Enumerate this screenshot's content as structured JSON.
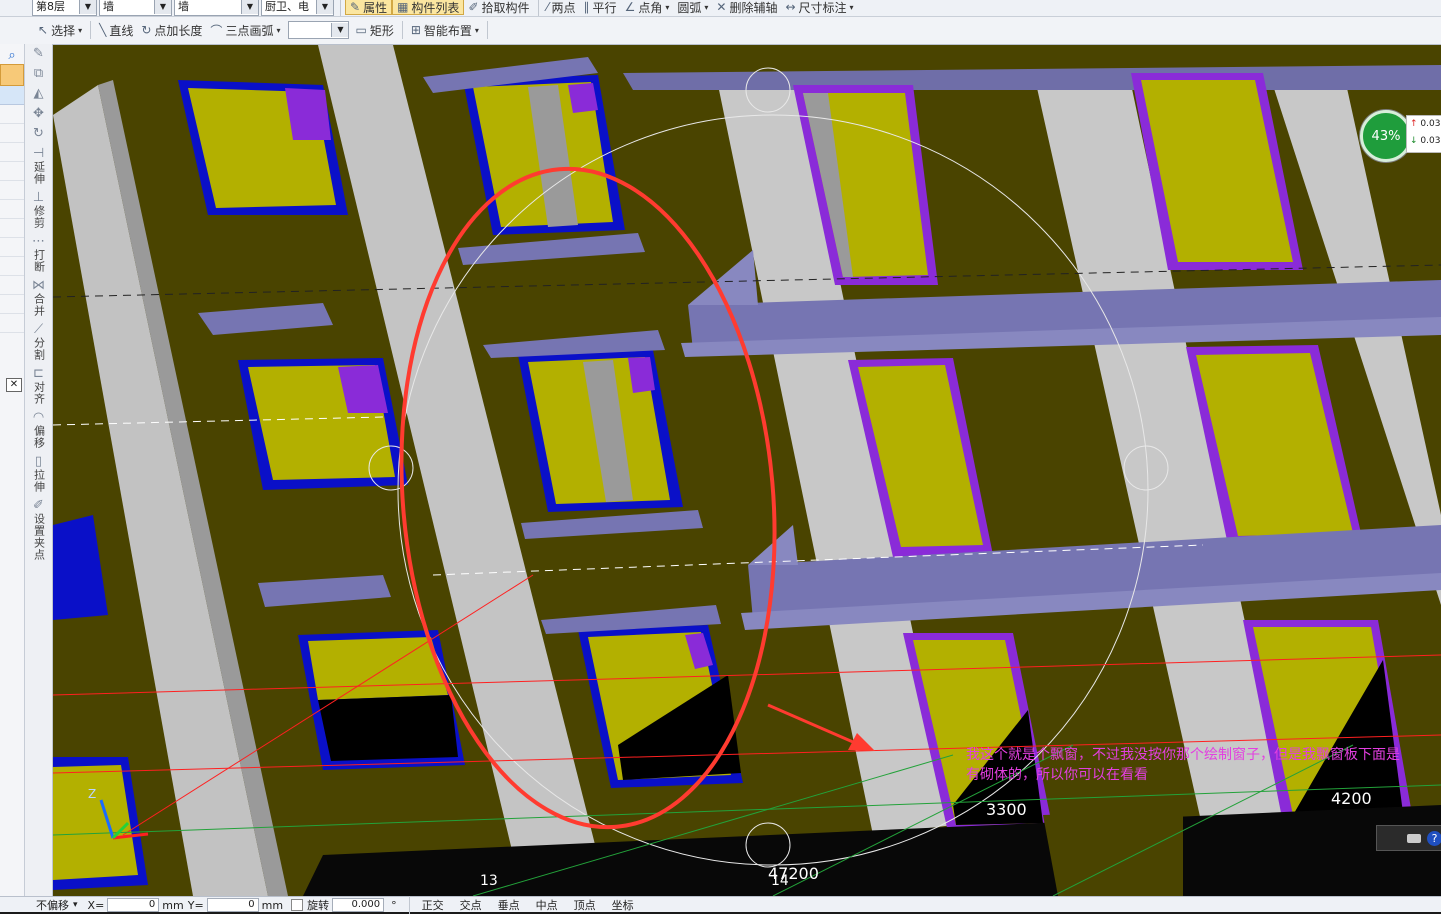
{
  "toolbar_top": {
    "floor_select": "第8层",
    "type_select_1": "墙",
    "type_select_2": "墙",
    "sub_select": "厨卫、电",
    "props_button": "属性",
    "component_list_button": "构件列表",
    "pick_component_button": "拾取构件",
    "two_points_button": "两点",
    "parallel_button": "平行",
    "point_angle_button": "点角",
    "arc_button": "圆弧",
    "delete_aux_button": "删除辅轴",
    "dimension_button": "尺寸标注"
  },
  "toolbar_draw": {
    "select_button": "选择",
    "line_button": "直线",
    "point_length_button": "点加长度",
    "three_point_arc_button": "三点画弧",
    "rect_button": "矩形",
    "smart_layout_button": "智能布置"
  },
  "left_tools": [
    {
      "icon": "pencil-icon",
      "label": ""
    },
    {
      "icon": "copy-icon",
      "label": ""
    },
    {
      "icon": "mirror-icon",
      "label": ""
    },
    {
      "icon": "move-icon",
      "label": ""
    },
    {
      "icon": "rotate-icon",
      "label": ""
    },
    {
      "icon": "extend-icon",
      "label": "延伸"
    },
    {
      "icon": "trim-icon",
      "label": "修剪"
    },
    {
      "icon": "break-icon",
      "label": "打断"
    },
    {
      "icon": "merge-icon",
      "label": "合并"
    },
    {
      "icon": "split-icon",
      "label": "分割"
    },
    {
      "icon": "align-icon",
      "label": "对齐"
    },
    {
      "icon": "offset-icon",
      "label": "偏移"
    },
    {
      "icon": "stretch-icon",
      "label": "拉伸"
    },
    {
      "icon": "grip-icon",
      "label": "设置夹点"
    }
  ],
  "viewport": {
    "annotation_text": "我这个就是个飘窗，不过我没按你那个绘制窗子，但是我飘窗板下面是有砌体的，所以你可以在看看",
    "dim_3300": "3300",
    "dim_4200": "4200",
    "dim_47200": "47200",
    "axis_13": "13",
    "axis_14": "14",
    "gauge_percent": "43%",
    "speed_up": "0.03",
    "speed_down": "0.03",
    "axis_z": "Z",
    "colors": {
      "wall": "#4a4400",
      "column": "#bebebe",
      "glass": "#b3b000",
      "slab": "#7675b2",
      "frame_blue": "#0a10c8",
      "frame_purple": "#8a2bd8",
      "red_mark": "#ff3b30"
    }
  },
  "status_bar": {
    "no_offset_select": "不偏移",
    "x_label": "X=",
    "x_value": "0",
    "mm1": "mm",
    "y_label": "Y=",
    "y_value": "0",
    "mm2": "mm",
    "rotate_label": "旋转",
    "rotate_value": "0.000",
    "snap_ortho": "正交",
    "snap_intersection": "交点",
    "snap_perpendicular": "垂点",
    "snap_midpoint": "中点",
    "snap_vertex": "顶点",
    "snap_coordinate": "坐标"
  }
}
